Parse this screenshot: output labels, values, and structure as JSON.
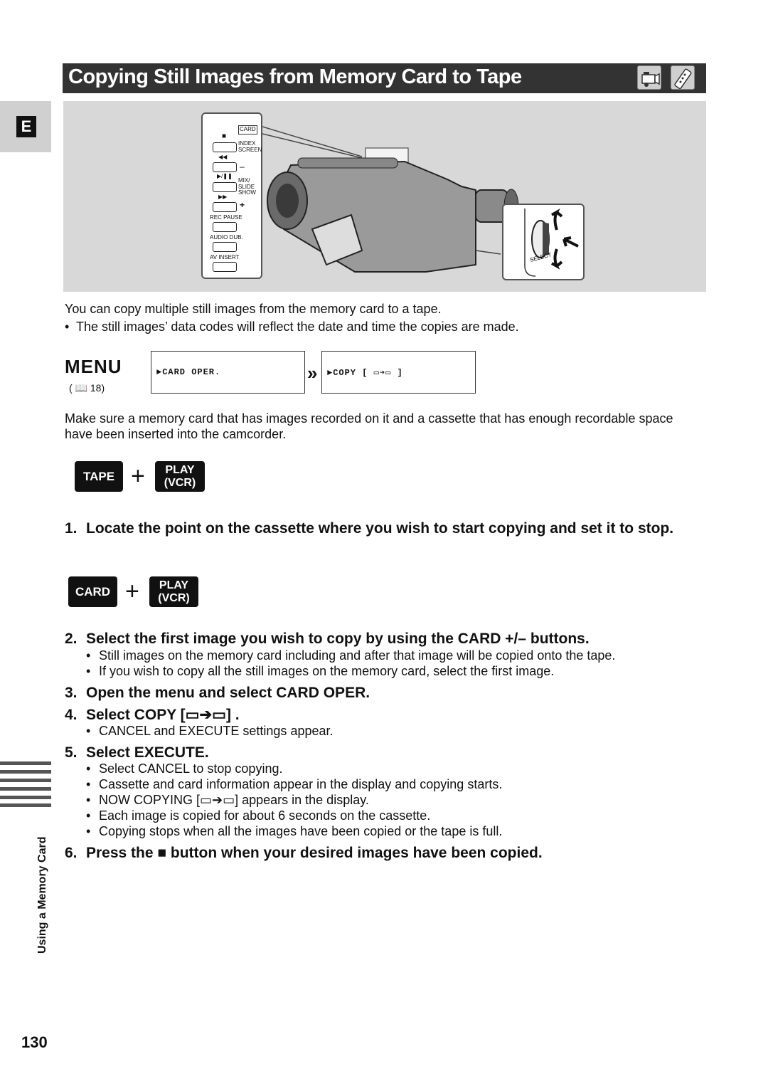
{
  "side": {
    "language_tab": "E",
    "section_label": "Using a Memory Card",
    "page_number": "130"
  },
  "header": {
    "title": "Copying Still Images from Memory Card to Tape",
    "icons": [
      "camcorder-icon",
      "remote-control-icon"
    ]
  },
  "illustration": {
    "panel_labels": {
      "card": "CARD",
      "stop_symbol": "■",
      "index_screen": "INDEX SCREEN",
      "rewind_symbol": "◀◀",
      "minus": "–",
      "play_pause_symbol": "▶/❚❚",
      "mix_slide_show": "MIX/ SLIDE SHOW",
      "ff_symbol": "▶▶",
      "plus": "+",
      "rec_pause": "REC PAUSE",
      "audio_dub": "AUDIO DUB.",
      "av_insert": "AV INSERT"
    },
    "dial_label": "SELECT"
  },
  "intro": {
    "text": "You can copy multiple still images from the memory card to a tape.",
    "bullet": "The still images’ data codes will reflect the date and time the copies are made."
  },
  "menu": {
    "label": "MENU",
    "reference": "( 📖 18)",
    "box1": "►CARD OPER.",
    "arrow": "»",
    "box2": "►COPY [ ▭➔▭ ]"
  },
  "prereq": "Make sure a memory card that has images recorded on it and a cassette that has enough recordable space have been inserted into the camcorder.",
  "modes": [
    {
      "left": "TAPE",
      "plus": "+",
      "right_line1": "PLAY",
      "right_line2": "(VCR)"
    },
    {
      "left": "CARD",
      "plus": "+",
      "right_line1": "PLAY",
      "right_line2": "(VCR)"
    }
  ],
  "steps": [
    {
      "num": "1.",
      "text": "Locate the point on the cassette where you wish to start copying and set it to stop.",
      "bullets": []
    },
    {
      "num": "2.",
      "text": "Select the first image you wish to copy by using the CARD +/– buttons.",
      "bullets": [
        "Still images on the memory card including and after that image will be copied onto the tape.",
        "If you wish to copy all the still images on the memory card, select the first image."
      ]
    },
    {
      "num": "3.",
      "text": "Open the menu and select CARD OPER.",
      "bullets": []
    },
    {
      "num": "4.",
      "text": "Select COPY [▭➔▭] .",
      "bullets": [
        "CANCEL and EXECUTE settings appear."
      ]
    },
    {
      "num": "5.",
      "text": "Select EXECUTE.",
      "bullets": [
        "Select CANCEL to stop copying.",
        "Cassette and card information appear in the display and copying starts.",
        "NOW COPYING [▭➔▭] appears in the display.",
        "Each image is copied for about 6 seconds on the cassette.",
        "Copying stops when all the images have been copied or the tape is full."
      ]
    },
    {
      "num": "6.",
      "text": "Press the ■ button when your desired images have been copied.",
      "bullets": []
    }
  ],
  "bullet_char": "•"
}
